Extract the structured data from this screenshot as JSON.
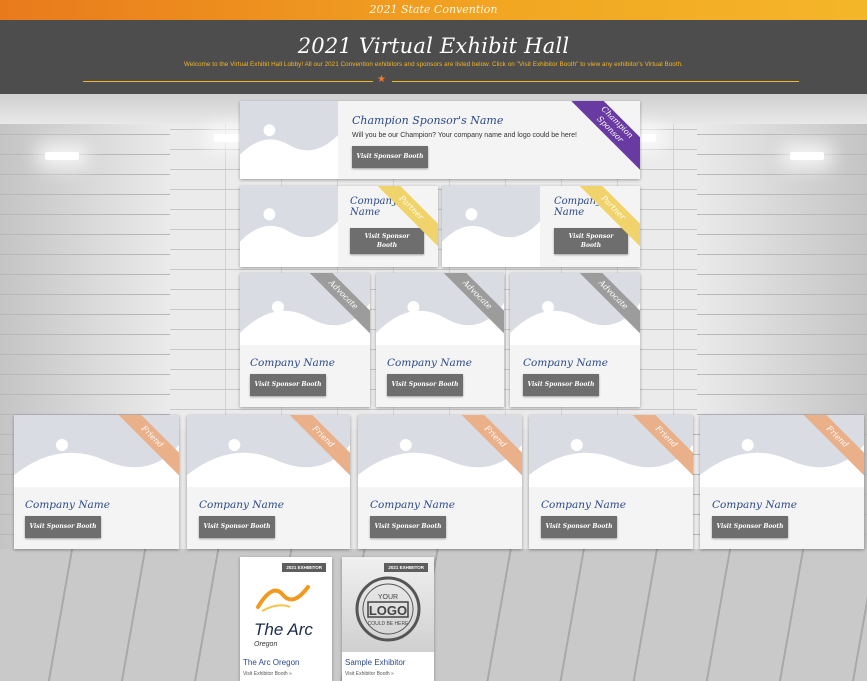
{
  "topbar": {
    "title": "2021 State Convention"
  },
  "header": {
    "title": "2021 Virtual Exhibit Hall",
    "welcome": "Welcome to the Virtual Exhibit Hall Lobby! All our 2021 Convention exhibitors and sponsors are listed below. Click on \"Visit Exhibitor Booth\" to view any exhibitor's Virtual Booth.",
    "star": "★"
  },
  "colors": {
    "accent": "#f4b629",
    "header_bg": "#4d4d4d",
    "name_blue": "#2b4a8a",
    "button": "#6e6e6e"
  },
  "champion": {
    "name": "Champion Sponsor's Name",
    "text": "Will you be our Champion? Your company name and logo could be here!",
    "button": "Visit Sponsor Booth",
    "ribbon_l1": "Champion",
    "ribbon_l2": "Sponsor"
  },
  "partners": [
    {
      "name_l1": "Company",
      "name_l2": "Name",
      "button_l1": "Visit Sponsor",
      "button_l2": "Booth",
      "ribbon": "Partner"
    },
    {
      "name_l1": "Company",
      "name_l2": "Name",
      "button_l1": "Visit Sponsor",
      "button_l2": "Booth",
      "ribbon": "Partner"
    }
  ],
  "advocates": [
    {
      "name": "Company Name",
      "button": "Visit Sponsor Booth",
      "ribbon": "Advocate"
    },
    {
      "name": "Company Name",
      "button": "Visit Sponsor Booth",
      "ribbon": "Advocate"
    },
    {
      "name": "Company Name",
      "button": "Visit Sponsor Booth",
      "ribbon": "Advocate"
    }
  ],
  "friends": [
    {
      "name": "Company Name",
      "button": "Visit Sponsor Booth",
      "ribbon": "Friend"
    },
    {
      "name": "Company Name",
      "button": "Visit Sponsor Booth",
      "ribbon": "Friend"
    },
    {
      "name": "Company Name",
      "button": "Visit Sponsor Booth",
      "ribbon": "Friend"
    },
    {
      "name": "Company Name",
      "button": "Visit Sponsor Booth",
      "ribbon": "Friend"
    },
    {
      "name": "Company Name",
      "button": "Visit Sponsor Booth",
      "ribbon": "Friend"
    }
  ],
  "exhibitors": [
    {
      "badge": "2021 EXHIBITOR",
      "name": "The Arc Oregon",
      "link": "Visit Exhibitor Booth »",
      "logo_main": "The Arc",
      "logo_sub": "Oregon"
    },
    {
      "badge": "2021 EXHIBITOR",
      "name": "Sample Exhibitor",
      "link": "Visit Exhibitor Booth »",
      "logo_l1": "YOUR",
      "logo_l2": "LOGO",
      "logo_l3": "COULD BE HERE"
    }
  ]
}
